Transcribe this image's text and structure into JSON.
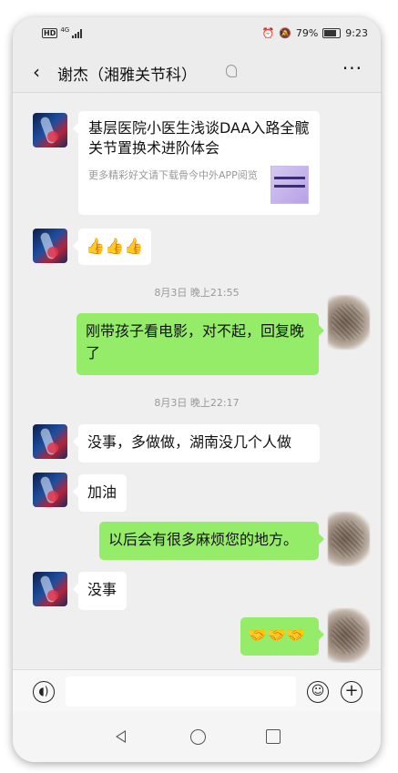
{
  "status_bar": {
    "network": "HD",
    "network_gen": "4G",
    "battery_percent": "79%",
    "battery_level": 0.79,
    "time": "9:23",
    "icons": [
      "alarm-icon",
      "mute-icon",
      "battery-icon",
      "signal-icon"
    ]
  },
  "header": {
    "back_icon": "‹",
    "title": "谢杰（湘雅关节科）",
    "more_icon": "···"
  },
  "messages": {
    "card": {
      "title": "基层医院小医生浅谈DAA入路全髋关节置换术进阶体会",
      "desc": "更多精彩好文请下载骨今中外APP阅览"
    },
    "msg1": "👍👍👍",
    "time1": "8月3日 晚上21:55",
    "msg2": "刚带孩子看电影，对不起，回复晚了",
    "time2": "8月3日 晚上22:17",
    "msg3": "没事，多做做，湖南没几个人做",
    "msg4": "加油",
    "msg5": "以后会有很多麻烦您的地方。",
    "msg6": "没事",
    "msg7": "🤝🤝🤝"
  },
  "input_bar": {
    "voice_icon": "🔊",
    "emoji_icon": "☺",
    "plus_icon": "+"
  },
  "colors": {
    "self_bubble": "#95ec69",
    "other_bubble": "#ffffff",
    "chat_background": "#efefef"
  }
}
